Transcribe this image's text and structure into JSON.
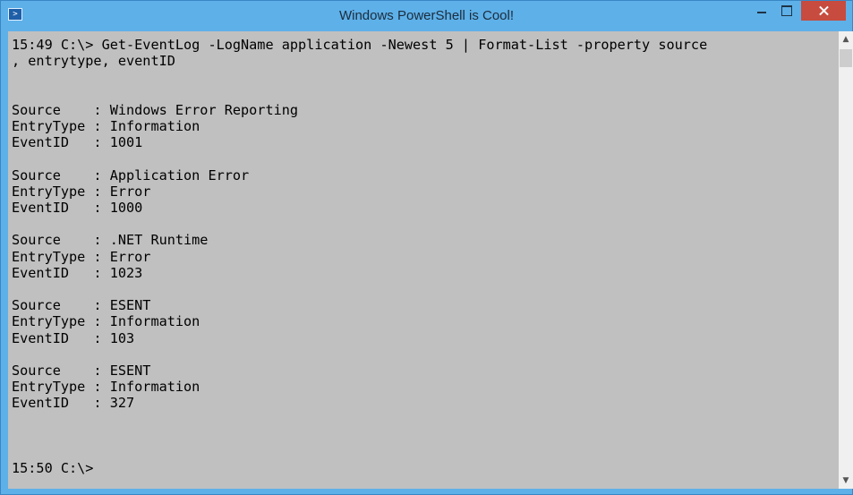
{
  "window": {
    "title": "Windows PowerShell is Cool!",
    "icon": "powershell-icon"
  },
  "console": {
    "lines": [
      "15:49 C:\\> Get-EventLog -LogName application -Newest 5 | Format-List -property source",
      ", entrytype, eventID",
      "",
      "",
      "Source    : Windows Error Reporting",
      "EntryType : Information",
      "EventID   : 1001",
      "",
      "Source    : Application Error",
      "EntryType : Error",
      "EventID   : 1000",
      "",
      "Source    : .NET Runtime",
      "EntryType : Error",
      "EventID   : 1023",
      "",
      "Source    : ESENT",
      "EntryType : Information",
      "EventID   : 103",
      "",
      "Source    : ESENT",
      "EntryType : Information",
      "EventID   : 327",
      "",
      "",
      "",
      "15:50 C:\\>"
    ]
  },
  "controls": {
    "minimize_icon": "minimize-icon",
    "maximize_icon": "maximize-icon",
    "close_icon": "close-icon"
  },
  "colors": {
    "titlebar": "#5eb0e8",
    "console_background": "#c0c0c0",
    "console_text": "#000000",
    "close_button": "#c74b3e"
  }
}
